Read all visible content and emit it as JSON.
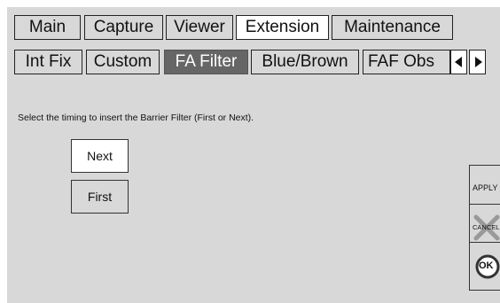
{
  "tabs_row1": [
    {
      "label": "Main",
      "state": "normal"
    },
    {
      "label": "Capture",
      "state": "normal"
    },
    {
      "label": "Viewer",
      "state": "normal"
    },
    {
      "label": "Extension",
      "state": "selected"
    },
    {
      "label": "Maintenance",
      "state": "normal"
    }
  ],
  "tabs_row2": [
    {
      "label": "Int Fix",
      "state": "normal"
    },
    {
      "label": "Custom",
      "state": "normal"
    },
    {
      "label": "FA Filter",
      "state": "active"
    },
    {
      "label": "Blue/Brown",
      "state": "normal"
    },
    {
      "label": "FAF Obs",
      "state": "normal"
    }
  ],
  "tab_scroll": {
    "left_icon": "triangle-left-icon",
    "right_icon": "triangle-right-icon"
  },
  "content": {
    "instruction": "Select the timing to insert the Barrier Filter (First or Next).",
    "options": [
      {
        "label": "Next",
        "selected": true
      },
      {
        "label": "First",
        "selected": false
      }
    ]
  },
  "actions": {
    "apply_label": "APPLY",
    "cancel_label": "CANCEL",
    "ok_label": "OK"
  },
  "colors": {
    "panel_bg": "#d8d8d8",
    "active_tab_bg": "#666666",
    "selected_bg": "#ffffff",
    "border": "#222222"
  }
}
